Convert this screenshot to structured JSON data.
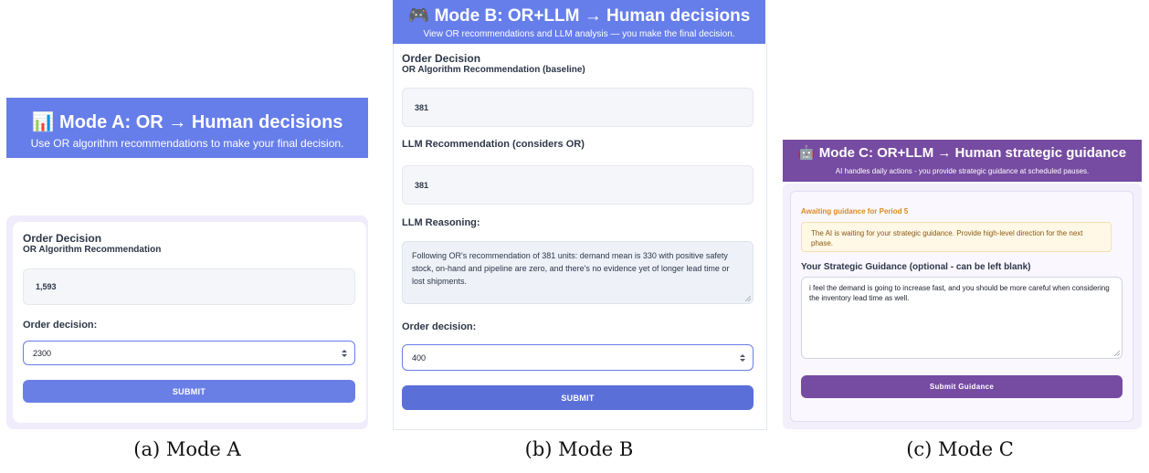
{
  "mode_a": {
    "icon": "📊",
    "title": "Mode A: OR → Human decisions",
    "subtitle": "Use OR algorithm recommendations to make your final decision.",
    "section_title": "Order Decision",
    "rec_label": "OR Algorithm Recommendation",
    "rec_value": "1,593",
    "order_label": "Order decision:",
    "order_value": "2300",
    "submit_label": "SUBMIT",
    "caption": "(a) Mode A"
  },
  "mode_b": {
    "icon": "🎮",
    "title": "Mode B: OR+LLM → Human decisions",
    "subtitle": "View OR recommendations and LLM analysis — you make the final decision.",
    "section_title": "Order Decision",
    "or_label": "OR Algorithm Recommendation (baseline)",
    "or_value": "381",
    "llm_label": "LLM Recommendation (considers OR)",
    "llm_value": "381",
    "reasoning_label": "LLM Reasoning:",
    "reasoning_text": "Following OR's recommendation of 381 units: demand mean is 330 with positive safety stock, on-hand and pipeline are zero, and there's no evidence yet of longer lead time or lost shipments.",
    "order_label": "Order decision:",
    "order_value": "400",
    "submit_label": "SUBMIT",
    "caption": "(b) Mode B"
  },
  "mode_c": {
    "icon": "🤖",
    "title": "Mode C: OR+LLM → Human strategic guidance",
    "subtitle": "AI handles daily actions - you provide strategic guidance at scheduled pauses.",
    "awaiting": "Awaiting guidance for Period 5",
    "notice": "The AI is waiting for your strategic guidance. Provide high-level direction for the next phase.",
    "guidance_label": "Your Strategic Guidance (optional - can be left blank)",
    "guidance_text": "i feel the demand is going to increase fast, and you should be more careful when considering the inventory lead time as well.",
    "submit_label": "Submit Guidance",
    "caption": "(c) Mode C"
  },
  "colors": {
    "accent_blue": "#667eea",
    "button_blue": "#5a6fd8",
    "accent_purple": "#764ba2",
    "awaiting_orange": "#dd8a1f",
    "notice_bg": "#fff8e6"
  }
}
